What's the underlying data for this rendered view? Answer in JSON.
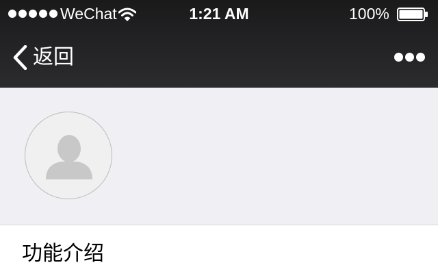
{
  "status_bar": {
    "carrier": "WeChat",
    "time": "1:21 AM",
    "battery_percent": "100%",
    "signal_icon": "signal-dots-icon",
    "wifi_icon": "wifi-icon",
    "battery_icon": "battery-full-icon"
  },
  "nav": {
    "back_label": "返回",
    "back_icon": "chevron-left-icon",
    "more_icon": "more-dots-icon"
  },
  "profile": {
    "avatar_icon": "person-placeholder-icon"
  },
  "intro": {
    "label": "功能介绍"
  },
  "colors": {
    "nav_background": "#232325",
    "page_background": "#efeff4",
    "avatar_background": "#f0f0f0",
    "avatar_glyph": "#c8c8c8"
  }
}
